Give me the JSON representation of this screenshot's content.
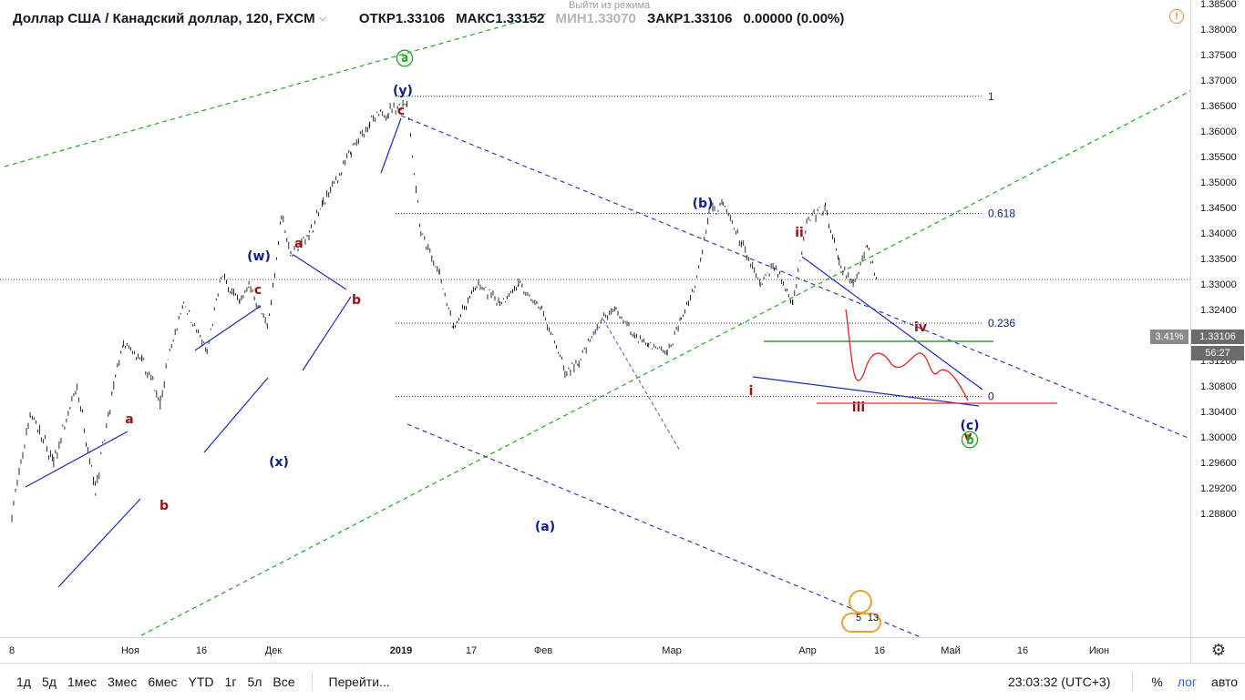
{
  "legend": {
    "title": "Доллар США / Канадский доллар, 120, FXCM",
    "open_label": "ОТКР",
    "open": "1.33106",
    "high_label": "МАКС",
    "high": "1.33152",
    "low_label": "МИН",
    "low": "1.33070",
    "close_label": "ЗАКР",
    "close": "1.33106",
    "change": "0.00000 (0.00%)"
  },
  "exit_tip": "Выйти из режима",
  "toolbar": {
    "timeframes": [
      "1д",
      "5д",
      "1мес",
      "3мес",
      "6мес",
      "YTD",
      "1г",
      "5л",
      "Все"
    ],
    "goto": "Перейти...",
    "clock": "23:03:32 (UTC+3)",
    "percent": "%",
    "log": "лог",
    "auto": "авто"
  },
  "current_price": {
    "value": "1.33106",
    "countdown": "56:27",
    "pct": "3.41%"
  },
  "calendar_badges": [
    "5",
    "13"
  ],
  "colors": {
    "accent": "#2962ff",
    "wave_blue": "#0b1e8a",
    "wave_red": "#9b0f0f",
    "green": "#22aa22",
    "red": "#e03030"
  },
  "chart_data": {
    "type": "candlestick",
    "symbol": "USDCAD",
    "interval": "120",
    "price_ticks": [
      "1.38500",
      "1.38000",
      "1.37500",
      "1.37000",
      "1.36500",
      "1.36000",
      "1.35500",
      "1.35000",
      "1.34500",
      "1.34000",
      "1.33500",
      "1.33000",
      "1.32400",
      "1.31800",
      "1.31200",
      "1.30800",
      "1.30400",
      "1.30000",
      "1.29600",
      "1.29200",
      "1.28800"
    ],
    "time_ticks": [
      {
        "label": "8",
        "bold": false
      },
      {
        "label": "Ноя",
        "bold": false
      },
      {
        "label": "16",
        "bold": false
      },
      {
        "label": "Дек",
        "bold": false
      },
      {
        "label": "2019",
        "bold": true
      },
      {
        "label": "17",
        "bold": false
      },
      {
        "label": "Фев",
        "bold": false
      },
      {
        "label": "Мар",
        "bold": false
      },
      {
        "label": "Апр",
        "bold": false
      },
      {
        "label": "16",
        "bold": false
      },
      {
        "label": "Май",
        "bold": false
      },
      {
        "label": "16",
        "bold": false
      },
      {
        "label": "Июн",
        "bold": false
      }
    ],
    "price_path": [
      [
        "2018-10-08",
        1.288
      ],
      [
        "2018-10-12",
        1.304
      ],
      [
        "2018-10-17",
        1.296
      ],
      [
        "2018-10-22",
        1.308
      ],
      [
        "2018-10-26",
        1.292
      ],
      [
        "2018-11-01",
        1.316
      ],
      [
        "2018-11-05",
        1.312
      ],
      [
        "2018-11-09",
        1.306
      ],
      [
        "2018-11-14",
        1.326
      ],
      [
        "2018-11-19",
        1.314
      ],
      [
        "2018-11-22",
        1.332
      ],
      [
        "2018-11-26",
        1.326
      ],
      [
        "2018-11-28",
        1.33
      ],
      [
        "2018-12-02",
        1.32
      ],
      [
        "2018-12-05",
        1.344
      ],
      [
        "2018-12-07",
        1.336
      ],
      [
        "2018-12-11",
        1.34
      ],
      [
        "2018-12-14",
        1.346
      ],
      [
        "2018-12-20",
        1.356
      ],
      [
        "2018-12-24",
        1.362
      ],
      [
        "2018-12-28",
        1.364
      ],
      [
        "2019-01-01",
        1.366
      ],
      [
        "2019-01-04",
        1.34
      ],
      [
        "2019-01-08",
        1.332
      ],
      [
        "2019-01-11",
        1.32
      ],
      [
        "2019-01-16",
        1.33
      ],
      [
        "2019-01-21",
        1.326
      ],
      [
        "2019-01-25",
        1.33
      ],
      [
        "2019-01-30",
        1.324
      ],
      [
        "2019-02-04",
        1.31
      ],
      [
        "2019-02-07",
        1.312
      ],
      [
        "2019-02-12",
        1.322
      ],
      [
        "2019-02-15",
        1.324
      ],
      [
        "2019-02-19",
        1.318
      ],
      [
        "2019-02-22",
        1.316
      ],
      [
        "2019-02-26",
        1.314
      ],
      [
        "2019-03-01",
        1.322
      ],
      [
        "2019-03-04",
        1.33
      ],
      [
        "2019-03-07",
        1.344
      ],
      [
        "2019-03-10",
        1.346
      ],
      [
        "2019-03-14",
        1.338
      ],
      [
        "2019-03-18",
        1.33
      ],
      [
        "2019-03-21",
        1.334
      ],
      [
        "2019-03-25",
        1.326
      ],
      [
        "2019-03-28",
        1.342
      ],
      [
        "2019-04-01",
        1.345
      ],
      [
        "2019-04-04",
        1.334
      ],
      [
        "2019-04-07",
        1.33
      ],
      [
        "2019-04-10",
        1.338
      ],
      [
        "2019-04-12",
        1.331
      ]
    ],
    "fib_levels": [
      {
        "label": "1",
        "price": 1.367
      },
      {
        "label": "0.618",
        "price": 1.344
      },
      {
        "label": "0.236",
        "price": 1.321
      },
      {
        "label": "0",
        "price": 1.3065
      }
    ],
    "wave_labels": [
      {
        "text": "ⓐ",
        "color": "green"
      },
      {
        "text": "(y)",
        "color": "blue"
      },
      {
        "text": "c",
        "color": "red"
      },
      {
        "text": "(w)",
        "color": "blue"
      },
      {
        "text": "a",
        "color": "red"
      },
      {
        "text": "b",
        "color": "red"
      },
      {
        "text": "c",
        "color": "red"
      },
      {
        "text": "a",
        "color": "red"
      },
      {
        "text": "b",
        "color": "red"
      },
      {
        "text": "(x)",
        "color": "blue"
      },
      {
        "text": "(b)",
        "color": "blue"
      },
      {
        "text": "ii",
        "color": "red"
      },
      {
        "text": "i",
        "color": "red"
      },
      {
        "text": "iii",
        "color": "red"
      },
      {
        "text": "iv",
        "color": "red"
      },
      {
        "text": "v",
        "color": "red"
      },
      {
        "text": "(c)",
        "color": "blue"
      },
      {
        "text": "ⓑ",
        "color": "green"
      },
      {
        "text": "(a)",
        "color": "blue"
      }
    ]
  }
}
